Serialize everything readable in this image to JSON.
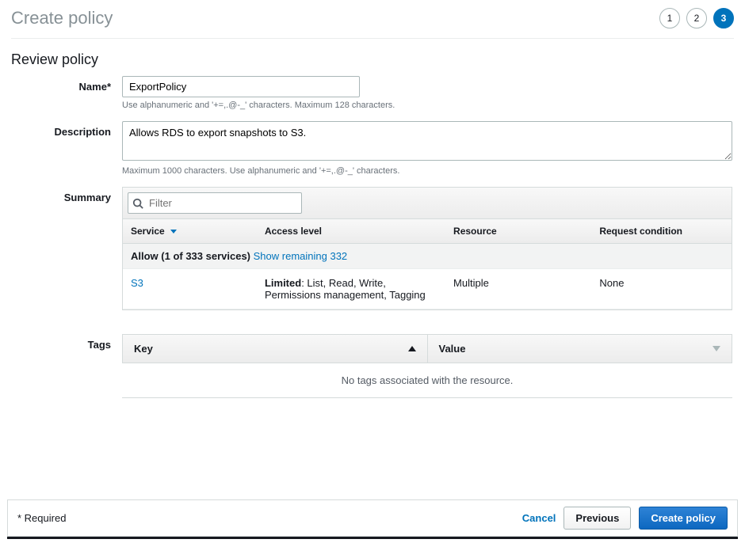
{
  "header": {
    "title": "Create policy",
    "steps": [
      "1",
      "2",
      "3"
    ],
    "activeStep": 2
  },
  "section": {
    "title": "Review policy"
  },
  "form": {
    "name": {
      "label": "Name*",
      "value": "ExportPolicy",
      "hint": "Use alphanumeric and '+=,.@-_' characters. Maximum 128 characters."
    },
    "description": {
      "label": "Description",
      "value": "Allows RDS to export snapshots to S3.",
      "hint": "Maximum 1000 characters. Use alphanumeric and '+=,.@-_' characters."
    },
    "summary": {
      "label": "Summary",
      "filterPlaceholder": "Filter",
      "columns": [
        "Service",
        "Access level",
        "Resource",
        "Request condition"
      ],
      "allowRow": {
        "text": "Allow (1 of 333 services)",
        "link": "Show remaining 332"
      },
      "row": {
        "service": "S3",
        "accessPrefix": "Limited",
        "accessDetail": ": List, Read, Write, Permissions management, Tagging",
        "resource": "Multiple",
        "condition": "None"
      }
    },
    "tags": {
      "label": "Tags",
      "keyHeader": "Key",
      "valueHeader": "Value",
      "empty": "No tags associated with the resource."
    }
  },
  "footer": {
    "required": "* Required",
    "cancel": "Cancel",
    "previous": "Previous",
    "create": "Create policy"
  }
}
